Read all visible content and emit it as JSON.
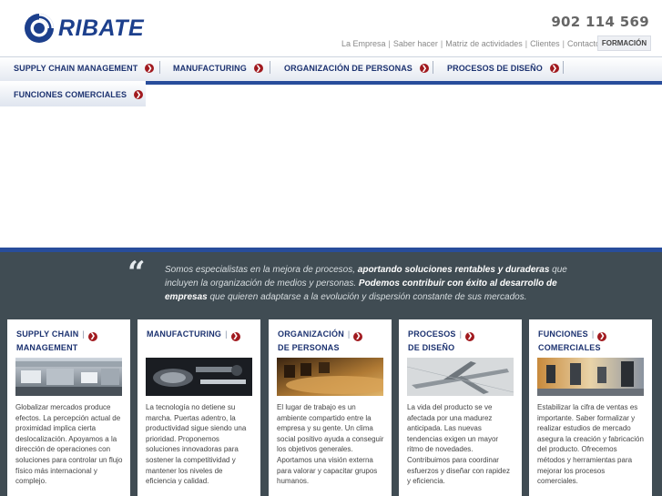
{
  "brand": {
    "name": "RIBATE",
    "color": "#1c3f8c"
  },
  "phone": "902 114 569",
  "top_links": [
    "La Empresa",
    "Saber hacer",
    "Matriz de actividades",
    "Clientes",
    "Contacto"
  ],
  "formacion": "FORMACIÓN",
  "nav": {
    "items": [
      {
        "label": "SUPPLY CHAIN MANAGEMENT"
      },
      {
        "label": "MANUFACTURING"
      },
      {
        "label": "ORGANIZACIÓN DE PERSONAS"
      },
      {
        "label": "PROCESOS DE DISEÑO"
      },
      {
        "label": "FUNCIONES COMERCIALES"
      }
    ],
    "arrow_icon": "arrow-right-circle-icon",
    "accent": "#a11a1f"
  },
  "quote": {
    "part1": "Somos especialistas en la mejora de procesos, ",
    "bold1": "aportando soluciones rentables y duraderas",
    "part2": " que incluyen la organización de medios y personas. ",
    "bold2": "Podemos contribuir con éxito al desarrollo de empresas",
    "part3": " que quieren adaptarse a la evolución y dispersión constante de sus mercados."
  },
  "cards": [
    {
      "title_line1": "SUPPLY CHAIN",
      "title_line2": "MANAGEMENT",
      "image": "warehouse-photo",
      "text": "Globalizar mercados produce efectos. La percepción actual de proximidad implica cierta deslocalización. Apoyamos a la dirección de operaciones con soluciones para controlar un flujo físico más internacional y complejo."
    },
    {
      "title_line1": "MANUFACTURING",
      "title_line2": "",
      "image": "machinery-photo",
      "text": "La tecnología no detiene su marcha. Puertas adentro, la productividad sigue siendo una prioridad. Proponemos soluciones innovadoras para sostener la competitividad y mantener los niveles de eficiencia y calidad."
    },
    {
      "title_line1": "ORGANIZACIÓN",
      "title_line2": "DE PERSONAS",
      "image": "meeting-table-photo",
      "text": "El lugar de trabajo es un ambiente compartido entre la empresa y su gente. Un clima social positivo ayuda a conseguir los objetivos generales. Aportamos una visión externa para valorar y capacitar grupos humanos."
    },
    {
      "title_line1": "PROCESOS",
      "title_line2": "DE DISEÑO",
      "image": "airplane-sketch-photo",
      "text": "La vida del producto se ve afectada por una madurez anticipada. Las nuevas tendencias exigen un mayor ritmo de novedades. Contribuimos para coordinar esfuerzos y diseñar con rapidez y eficiencia."
    },
    {
      "title_line1": "FUNCIONES",
      "title_line2": "COMERCIALES",
      "image": "office-chairs-photo",
      "text": "Estabilizar la cifra de ventas es importante. Saber formalizar y realizar estudios de mercado asegura la creación y fabricación del producto. Ofrecemos métodos y herramientas para mejorar los procesos comerciales."
    }
  ],
  "colors": {
    "panel": "#404c53",
    "nav_strip": "#284d9b",
    "nav_text": "#1c3270"
  }
}
